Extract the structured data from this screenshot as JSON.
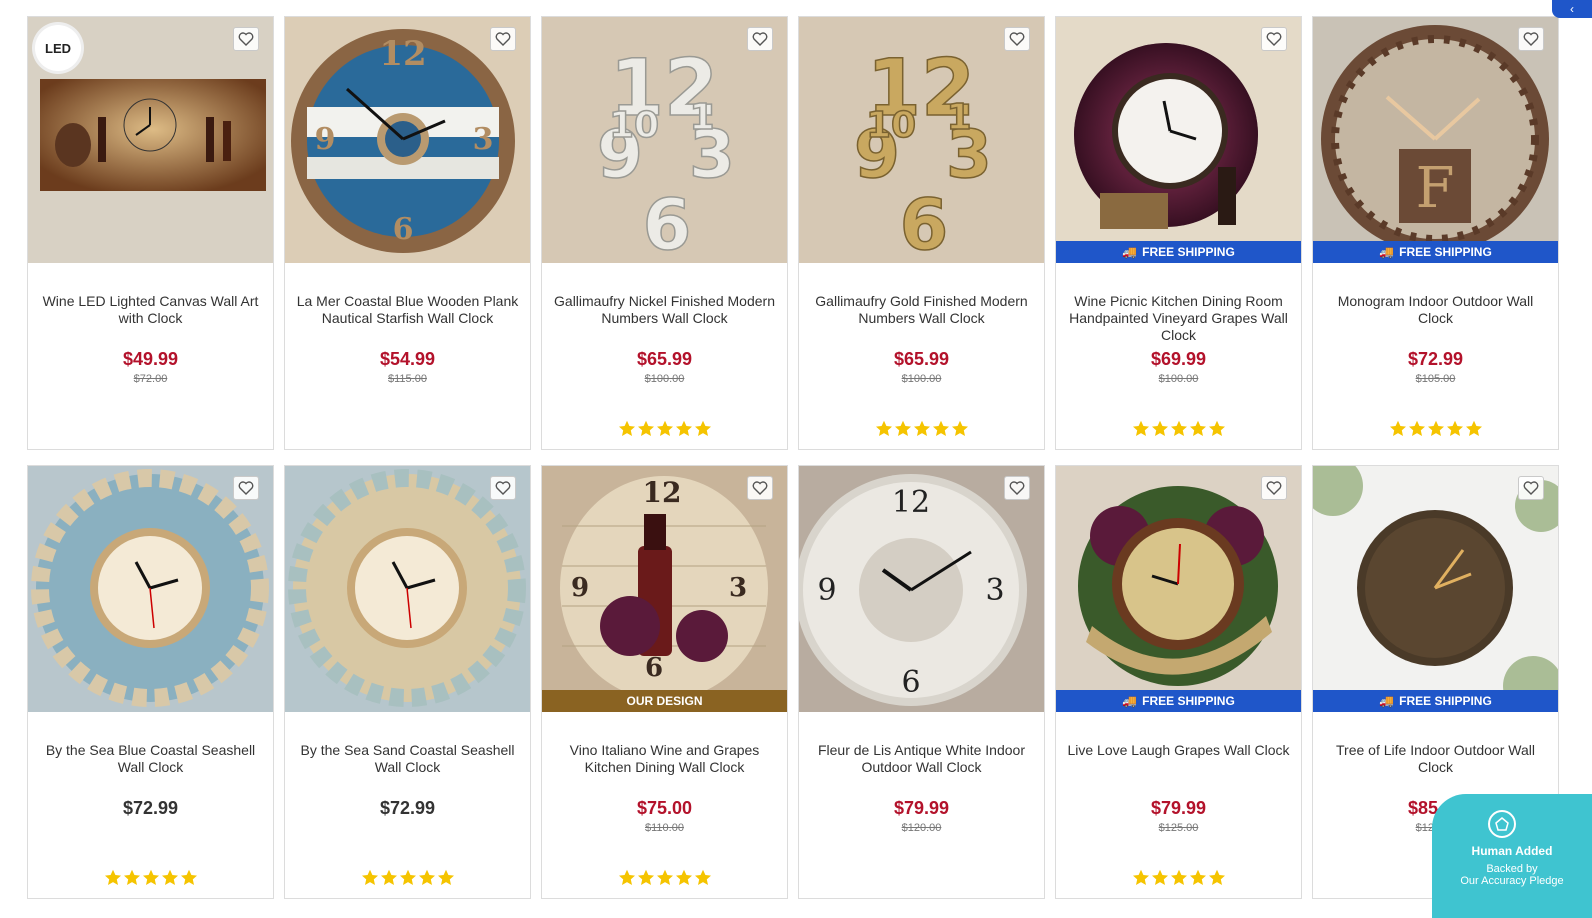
{
  "ui": {
    "free_shipping_label": "FREE SHIPPING",
    "our_design_label": "OUR DESIGN",
    "led_label": "LED",
    "star_color": "#f5c400",
    "sale_price_color": "#b3122b",
    "shipping_badge_color": "#1f56c9",
    "design_badge_color": "#8a6322"
  },
  "pledge": {
    "title": "Human Added",
    "line1": "Backed by",
    "line2": "Our Accuracy Pledge"
  },
  "products": [
    {
      "name": "Wine LED Lighted Canvas Wall Art with Clock",
      "price": "$49.99",
      "was": "$72.00",
      "stars": 0,
      "badge": "",
      "led": true
    },
    {
      "name": "La Mer Coastal Blue Wooden Plank Nautical Starfish Wall Clock",
      "price": "$54.99",
      "was": "$115.00",
      "stars": 0,
      "badge": ""
    },
    {
      "name": "Gallimaufry Nickel Finished Modern Numbers Wall Clock",
      "price": "$65.99",
      "was": "$100.00",
      "stars": 5,
      "badge": ""
    },
    {
      "name": "Gallimaufry Gold Finished Modern Numbers Wall Clock",
      "price": "$65.99",
      "was": "$100.00",
      "stars": 5,
      "badge": ""
    },
    {
      "name": "Wine Picnic Kitchen Dining Room Handpainted Vineyard Grapes Wall Clock",
      "price": "$69.99",
      "was": "$100.00",
      "stars": 5,
      "badge": "ship"
    },
    {
      "name": "Monogram Indoor Outdoor Wall Clock",
      "price": "$72.99",
      "was": "$105.00",
      "stars": 5,
      "badge": "ship"
    },
    {
      "name": "By the Sea Blue Coastal Seashell Wall Clock",
      "price": "$72.99",
      "was": "",
      "stars": 5,
      "badge": ""
    },
    {
      "name": "By the Sea Sand Coastal Seashell Wall Clock",
      "price": "$72.99",
      "was": "",
      "stars": 5,
      "badge": ""
    },
    {
      "name": "Vino Italiano Wine and Grapes Kitchen Dining Wall Clock",
      "price": "$75.00",
      "was": "$110.00",
      "stars": 5,
      "badge": "design"
    },
    {
      "name": "Fleur de Lis Antique White Indoor Outdoor Wall Clock",
      "price": "$79.99",
      "was": "$120.00",
      "stars": 0,
      "badge": ""
    },
    {
      "name": "Live Love Laugh Grapes Wall Clock",
      "price": "$79.99",
      "was": "$125.00",
      "stars": 5,
      "badge": "ship"
    },
    {
      "name": "Tree of Life Indoor Outdoor Wall Clock",
      "price": "$85.99",
      "was": "$124.00",
      "stars": 0,
      "badge": "ship"
    }
  ]
}
